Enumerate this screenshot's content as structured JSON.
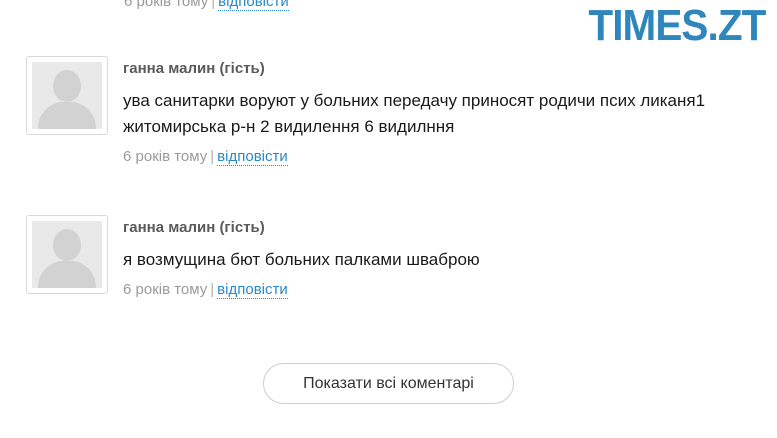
{
  "logo": {
    "text": "TIMES.ZT"
  },
  "prev_comment": {
    "time": "6 років тому",
    "separator": "|",
    "reply_label": "відповісти"
  },
  "comments": [
    {
      "author": "ганна малин (гість)",
      "text": "ува санитарки воруют у больних передачу приносят родичи псих ликаня1 житомирська р-н 2 видилення 6 видилння",
      "time": "6 років тому",
      "separator": "|",
      "reply_label": "відповісти",
      "avatar_icon": "default-user-silhouette"
    },
    {
      "author": "ганна малин (гість)",
      "text": "я возмущина бют больних палками шваброю",
      "time": "6 років тому",
      "separator": "|",
      "reply_label": "відповісти",
      "avatar_icon": "default-user-silhouette"
    }
  ],
  "show_all_button": {
    "label": "Показати всі коментарі"
  },
  "colors": {
    "accent": "#2a89c6",
    "logo": "#2f86bd",
    "muted_text": "#9a9a9a",
    "author_text": "#5a5a5a"
  }
}
